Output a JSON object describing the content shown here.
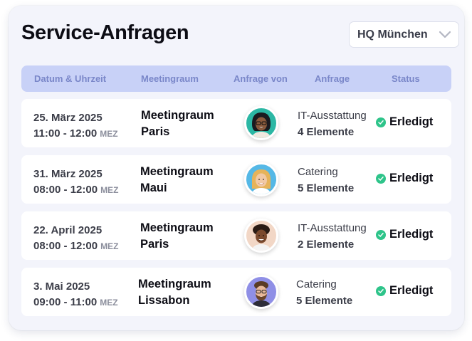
{
  "title": "Service-Anfragen",
  "location_select": {
    "value": "HQ München",
    "icon": "chevron-down-icon"
  },
  "columns": [
    "Datum & Uhrzeit",
    "Meetingraum",
    "Anfrage von",
    "Anfrage",
    "Status"
  ],
  "colors": {
    "card_bg": "#f3f4fb",
    "header_bg": "#c8d1f7",
    "header_text": "#7a87c9",
    "status_green": "#2ec48a"
  },
  "rows": [
    {
      "date": "25. März 2025",
      "time": "11:00 - 12:00",
      "tz": "MEZ",
      "room_1": "Meetingraum",
      "room_2": "Paris",
      "avatar": "person-avatar-icon",
      "avatar_bg": "#2bb7a4",
      "category": "IT-Ausstattung",
      "count": "4 Elemente",
      "status": "Erledigt"
    },
    {
      "date": "31. März 2025",
      "time": "08:00 - 12:00",
      "tz": "MEZ",
      "room_1": "Meetingraum",
      "room_2": "Maui",
      "avatar": "person-avatar-icon",
      "avatar_bg": "#55b8e6",
      "category": "Catering",
      "count": "5 Elemente",
      "status": "Erledigt"
    },
    {
      "date": "22. April 2025",
      "time": "08:00 - 12:00",
      "tz": "MEZ",
      "room_1": "Meetingraum",
      "room_2": "Paris",
      "avatar": "person-avatar-icon",
      "avatar_bg": "#f2d7c6",
      "category": "IT-Ausstattung",
      "count": "2 Elemente",
      "status": "Erledigt"
    },
    {
      "date": "3. Mai 2025",
      "time": "09:00 - 11:00",
      "tz": "MEZ",
      "room_1": "Meetingraum",
      "room_2": "Lissabon",
      "avatar": "person-avatar-icon",
      "avatar_bg": "#8f8fe6",
      "category": "Catering",
      "count": "5 Elemente",
      "status": "Erledigt"
    }
  ]
}
